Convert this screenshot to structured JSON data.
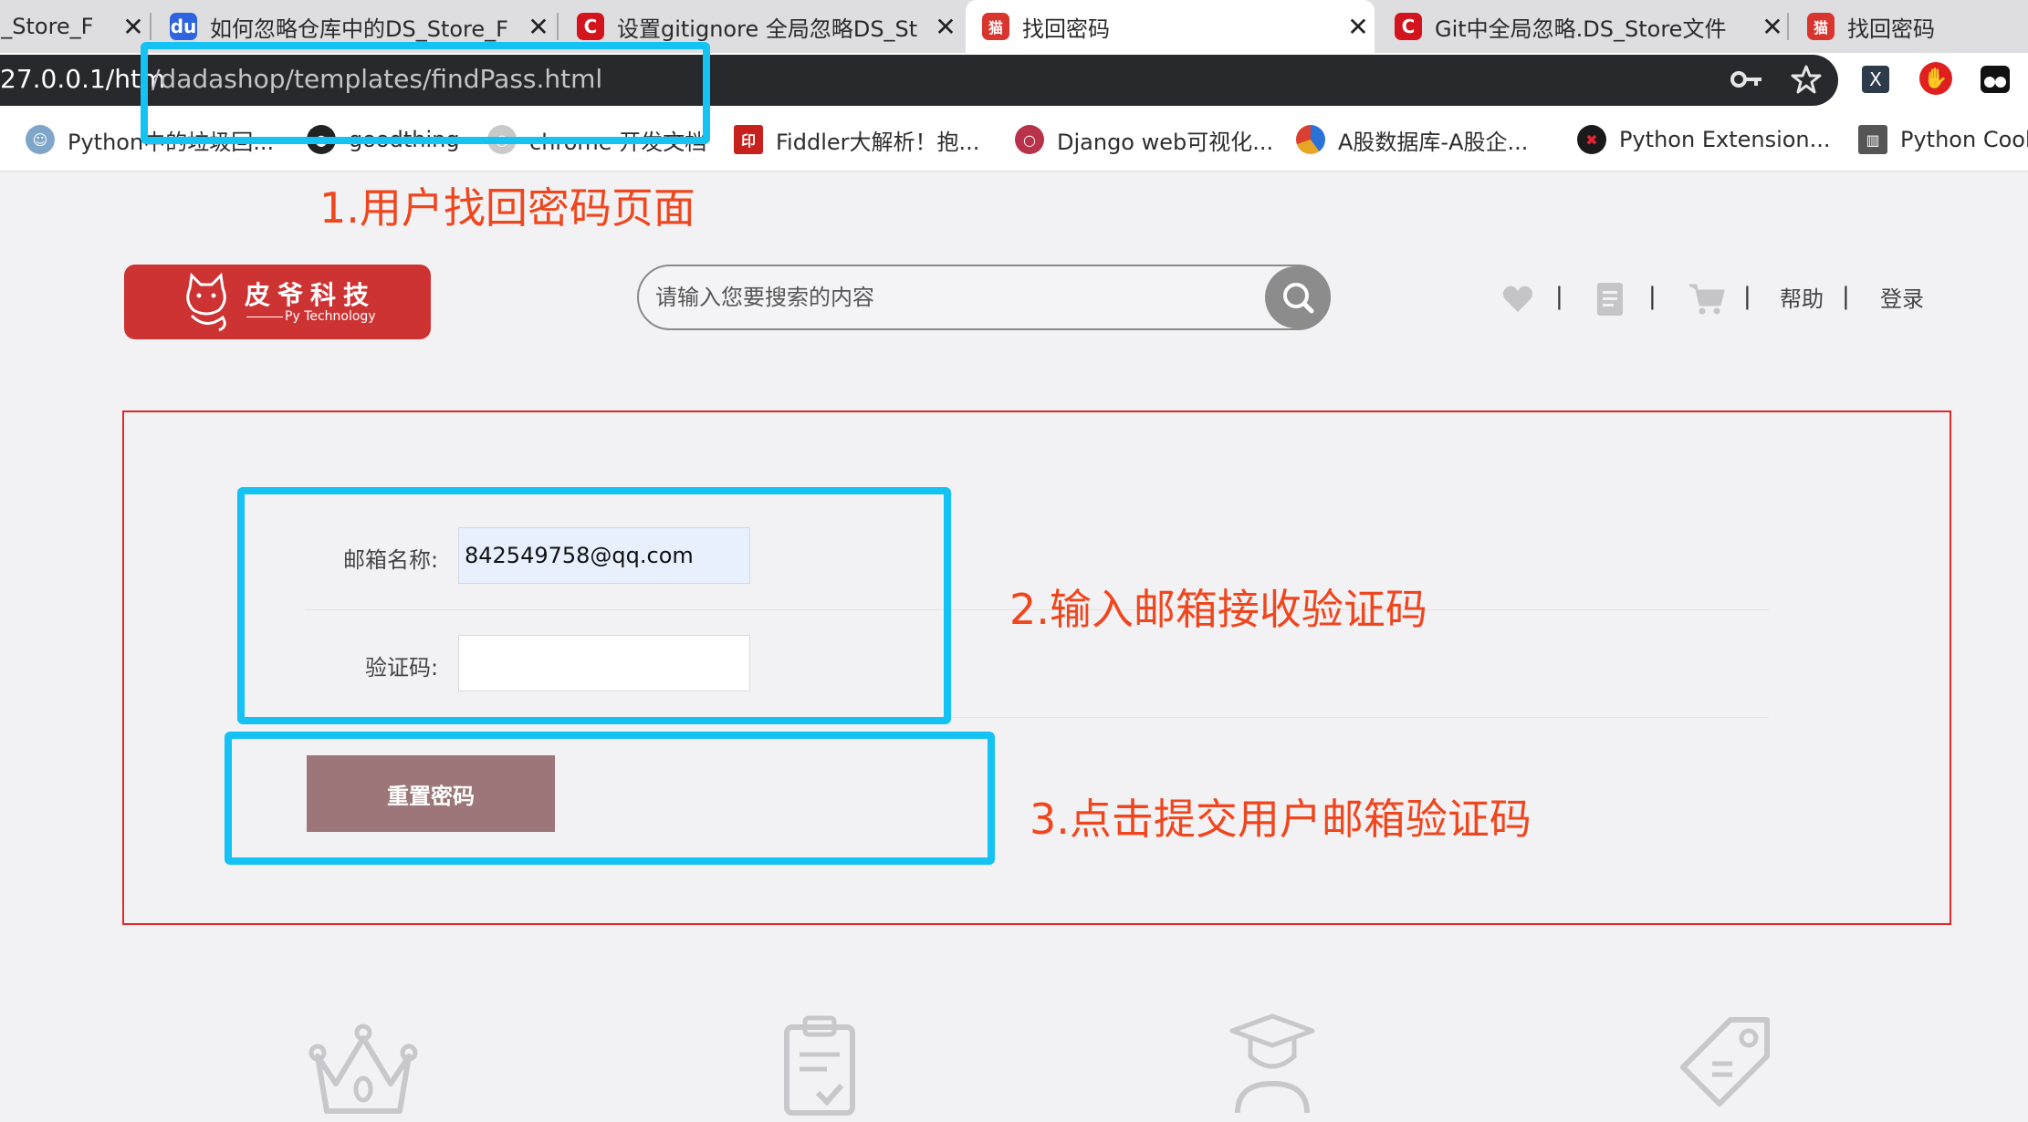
{
  "browser": {
    "tabs": [
      {
        "title": "S_Store_F",
        "favicon": "none",
        "close": "✕",
        "active": false
      },
      {
        "title": "如何忽略仓库中的DS_Store_F",
        "favicon": "baidu-paw",
        "close": "✕",
        "active": false
      },
      {
        "title": "设置gitignore 全局忽略DS_St",
        "favicon": "csdn-c",
        "close": "✕",
        "active": false
      },
      {
        "title": "找回密码",
        "favicon": "cat-logo",
        "close": "✕",
        "active": true
      },
      {
        "title": "Git中全局忽略.DS_Store文件",
        "favicon": "csdn-c",
        "close": "✕",
        "active": false
      },
      {
        "title": "找回密码",
        "favicon": "cat-logo",
        "close": "",
        "active": false
      }
    ],
    "url": {
      "host": "27.0.0.1/htm",
      "path": "/dadashop/templates/findPass.html"
    },
    "extensions": {
      "ext1": "X"
    },
    "bookmarks": [
      {
        "label": "Python中的垃圾回...",
        "icon": "avatar"
      },
      {
        "label": "goodthing",
        "icon": "github"
      },
      {
        "label": "chrome 开发文档",
        "icon": "chrome"
      },
      {
        "label": "Fiddler大解析！抱...",
        "icon": "red-stamp"
      },
      {
        "label": "Django web可视化...",
        "icon": "red-circle"
      },
      {
        "label": "A股数据库-A股企...",
        "icon": "pie"
      },
      {
        "label": "Python Extension...",
        "icon": "black-x"
      },
      {
        "label": "Python Cook",
        "icon": "book"
      }
    ]
  },
  "annotations": {
    "a1": "1.用户找回密码页面",
    "a2": "2.输入邮箱接收验证码",
    "a3": "3.点击提交用户邮箱验证码"
  },
  "site": {
    "logo_cn": "皮爷科技",
    "logo_en": "Py Technology",
    "search_placeholder": "请输入您要搜索的内容",
    "nav": {
      "sep": "|",
      "help": "帮助",
      "login": "登录"
    }
  },
  "form": {
    "email_label": "邮箱名称:",
    "email_value": "842549758@qq.com",
    "code_label": "验证码:",
    "code_value": "",
    "reset_label": "重置密码"
  },
  "colors": {
    "brand": "#cd3333",
    "annotation": "#f0461e",
    "highlight": "#14c2f4",
    "button": "#9c7678"
  }
}
